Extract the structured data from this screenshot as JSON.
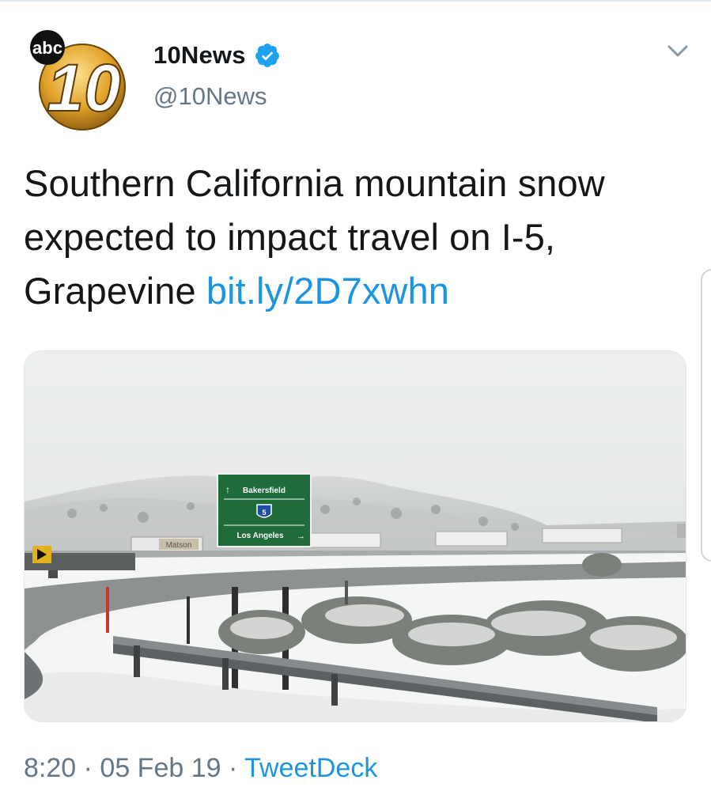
{
  "author": {
    "display_name": "10News",
    "handle": "@10News",
    "verified": true,
    "logo_text": "abc 10"
  },
  "tweet": {
    "text": "Southern California mountain snow expected to impact travel on I-5, Grapevine ",
    "link": "bit.ly/2D7xwhn"
  },
  "media": {
    "sign_top": "Bakersfield",
    "sign_route": "5",
    "sign_bottom": "Los Angeles",
    "truck_label": "Matson"
  },
  "meta": {
    "time": "8:20",
    "separator_1": " · ",
    "date": "05 Feb 19",
    "separator_2": " · ",
    "source": "TweetDeck"
  },
  "colors": {
    "link": "#1b95e0",
    "text": "#14171a",
    "secondary": "#657786",
    "verified": "#1da1f2",
    "logo_gold": "#e2a32a"
  },
  "icons": {
    "verified": "verified-badge-icon",
    "caret": "chevron-down-icon"
  }
}
